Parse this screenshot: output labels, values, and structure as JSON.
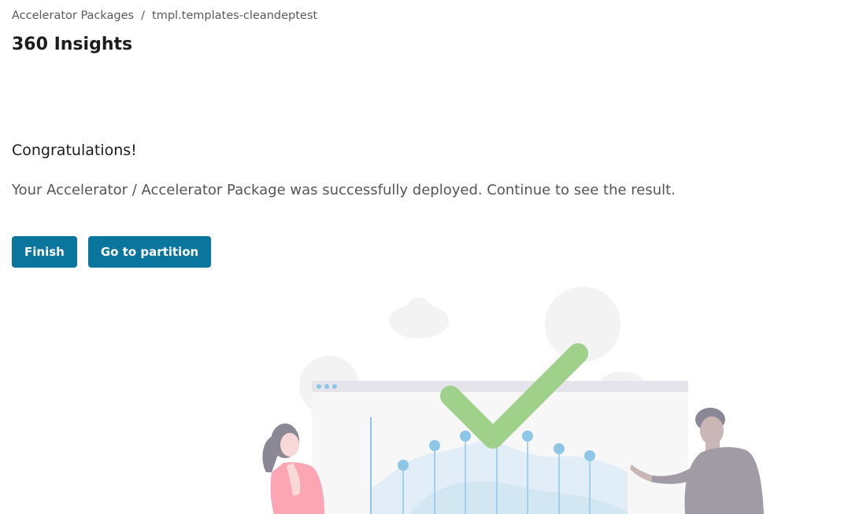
{
  "breadcrumb": {
    "parent": "Accelerator Packages",
    "separator": "/",
    "current": "tmpl.templates-cleandeptest"
  },
  "page": {
    "title": "360 Insights"
  },
  "result": {
    "heading": "Congratulations!",
    "message": "Your Accelerator / Accelerator Package was successfully deployed. Continue to see the result."
  },
  "actions": {
    "finish_label": "Finish",
    "partition_label": "Go to partition"
  },
  "colors": {
    "primary_button": "#0a759d",
    "check_mark": "#9fd18b",
    "chart_accent": "#8ec6e8"
  },
  "illustration": {
    "icon": "success-deployment-illustration"
  }
}
